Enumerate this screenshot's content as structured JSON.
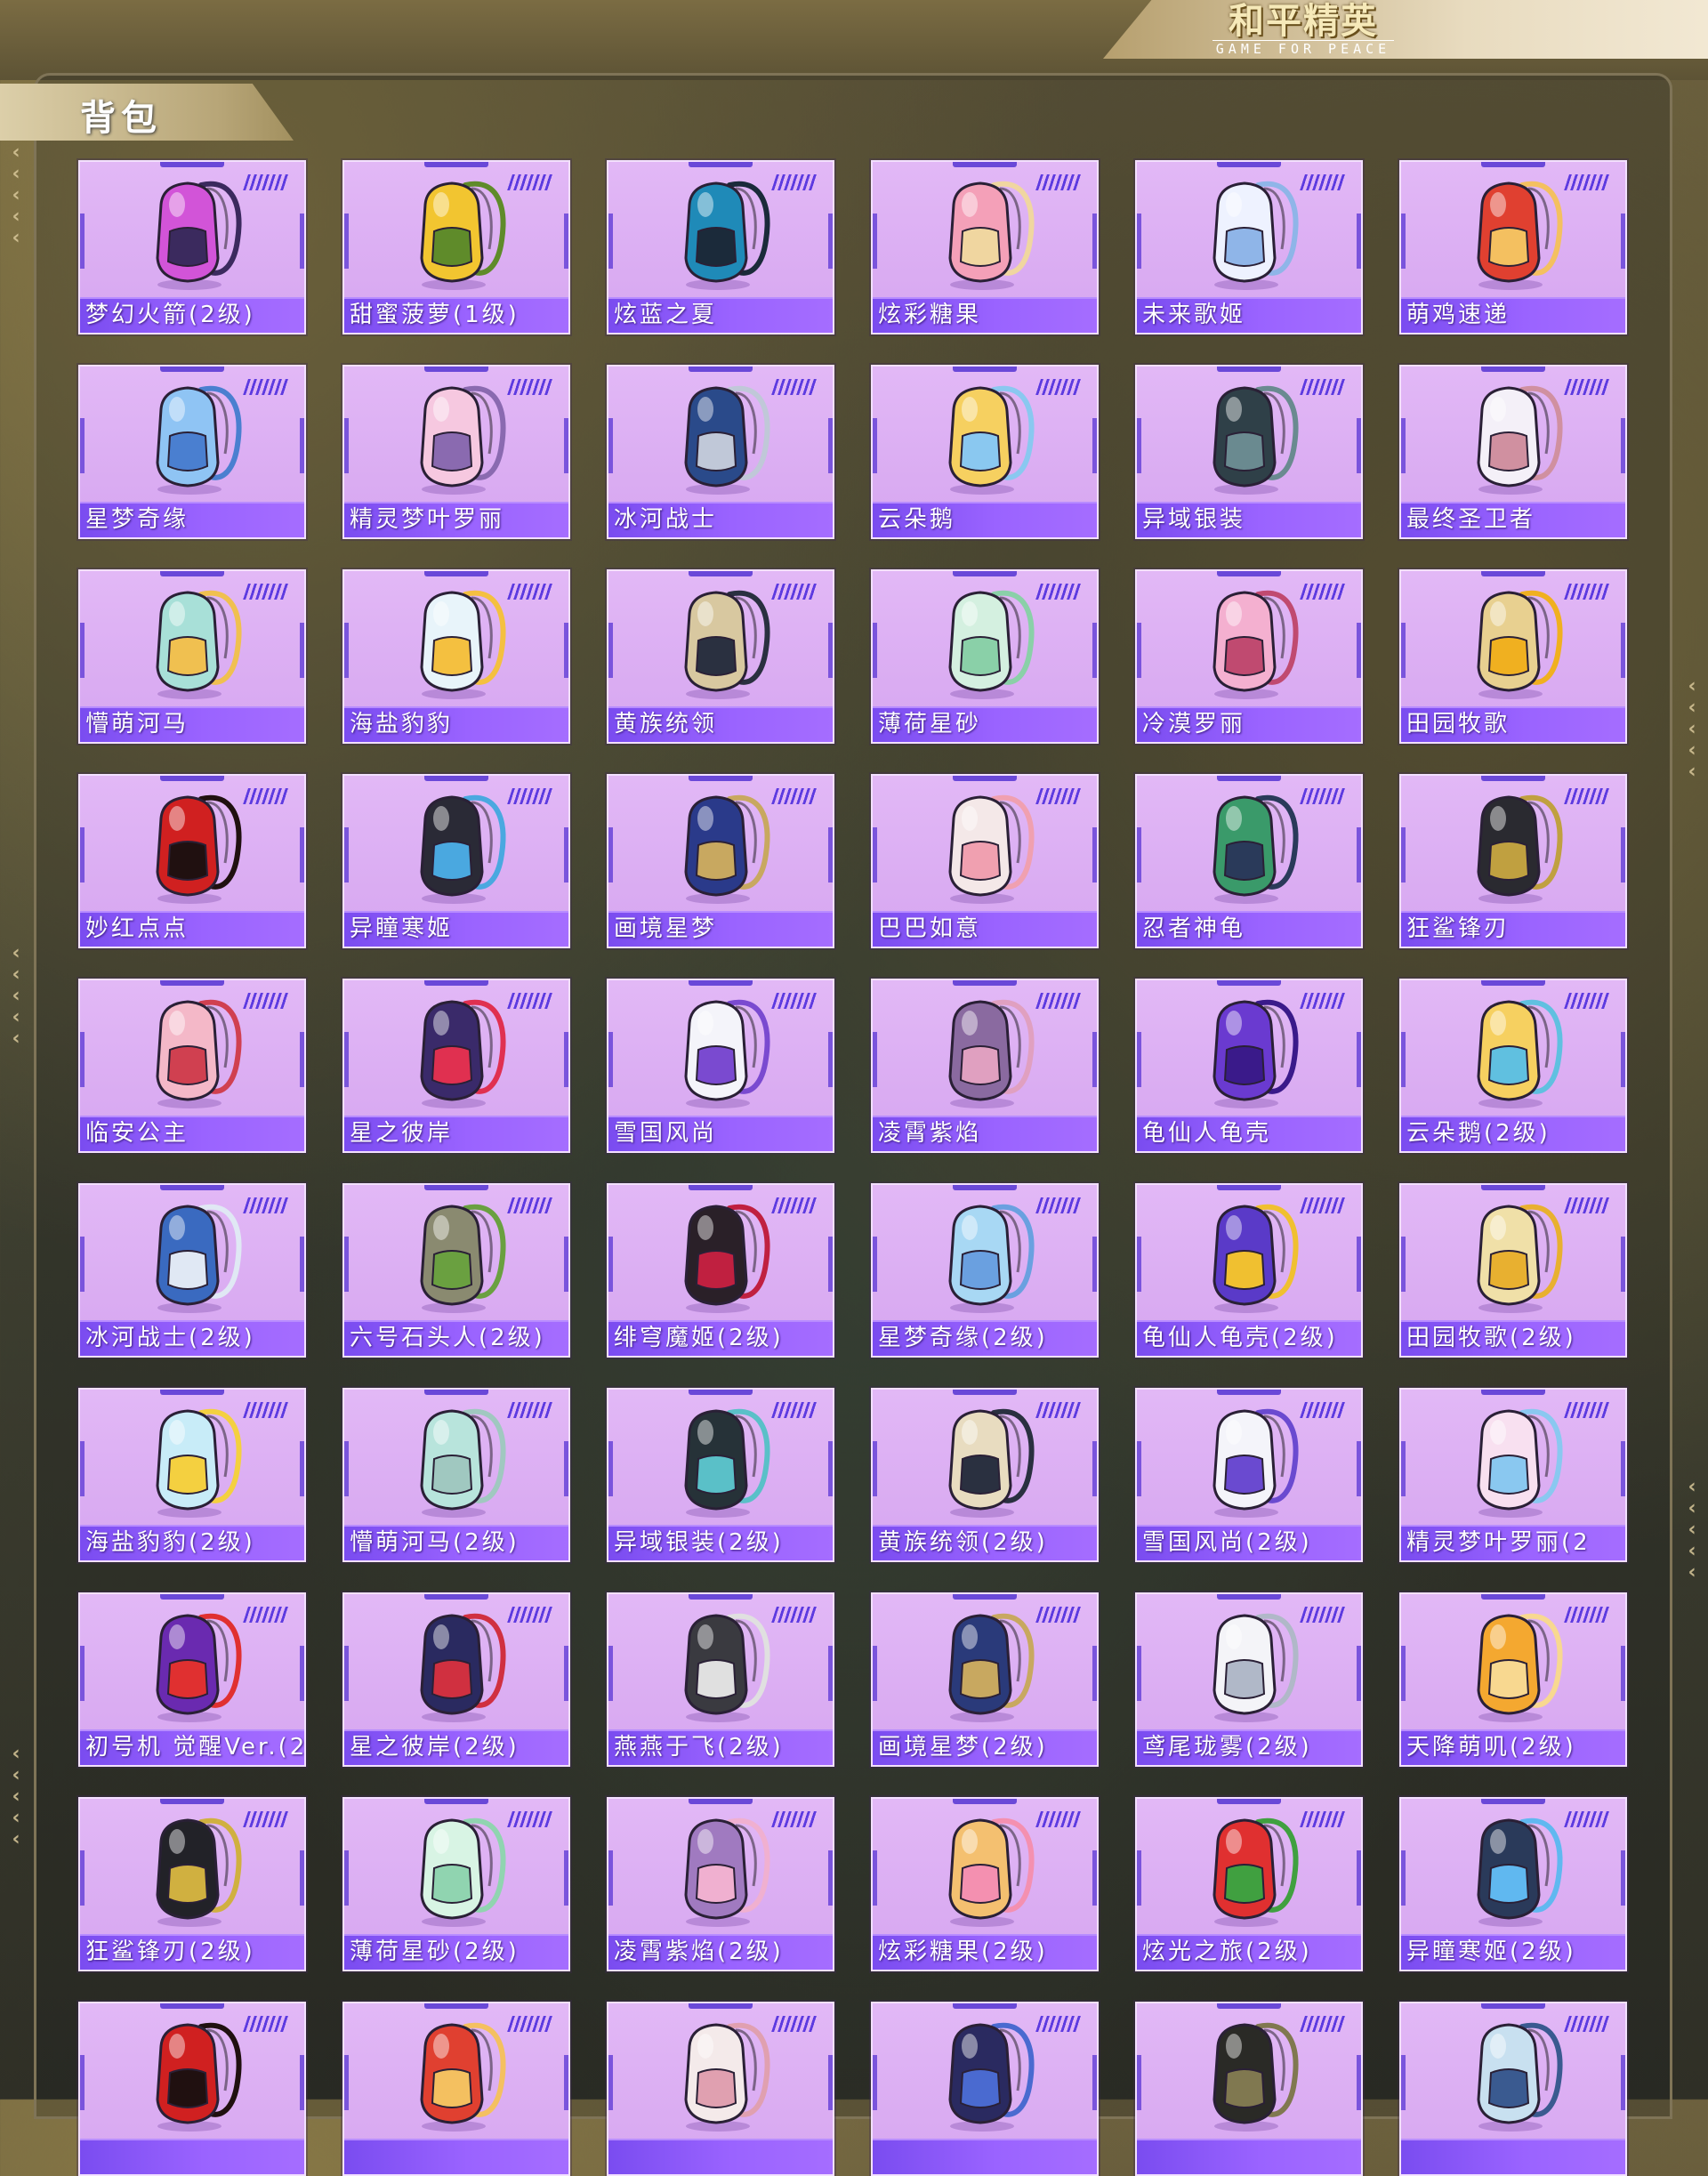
{
  "header": {
    "brand_main": "和平精英",
    "brand_sub": "GAME FOR PEACE"
  },
  "page": {
    "title": "背包"
  },
  "colors": {
    "card_bg": "#dcb0f4",
    "label_bar": "#8a58f5",
    "accent_stripe": "#5d3be0",
    "gold_tab": "#c9b98a"
  },
  "items": [
    {
      "label": "梦幻火箭(2级)",
      "icon": "rocket-backpack-icon",
      "c1": "#d254d8",
      "c2": "#3b2a5e"
    },
    {
      "label": "甜蜜菠萝(1级)",
      "icon": "pineapple-backpack-icon",
      "c1": "#f2c530",
      "c2": "#5f8b2a"
    },
    {
      "label": "炫蓝之夏",
      "icon": "blue-backpack-icon",
      "c1": "#1f8ab8",
      "c2": "#1b2a3a"
    },
    {
      "label": "炫彩糖果",
      "icon": "donut-backpack-icon",
      "c1": "#f4a0b8",
      "c2": "#f0d6a0"
    },
    {
      "label": "未来歌姬",
      "icon": "idol-backpack-icon",
      "c1": "#eef2ff",
      "c2": "#8fb5e8"
    },
    {
      "label": "萌鸡速递",
      "icon": "chick-backpack-icon",
      "c1": "#e04030",
      "c2": "#f4c060"
    },
    {
      "label": "星梦奇缘",
      "icon": "swan-backpack-icon",
      "c1": "#8fc4f4",
      "c2": "#4a7fd0"
    },
    {
      "label": "精灵梦叶罗丽",
      "icon": "heart-backpack-icon",
      "c1": "#f6c8e0",
      "c2": "#8a6ab0"
    },
    {
      "label": "冰河战士",
      "icon": "armor-backpack-icon",
      "c1": "#2a4a8a",
      "c2": "#c0c8d8"
    },
    {
      "label": "云朵鹅",
      "icon": "goose-backpack-icon",
      "c1": "#f6d060",
      "c2": "#8ac8f0"
    },
    {
      "label": "异域银装",
      "icon": "silver-backpack-icon",
      "c1": "#2f4048",
      "c2": "#6a8a90"
    },
    {
      "label": "最终圣卫者",
      "icon": "wing-backpack-icon",
      "c1": "#f4f0f8",
      "c2": "#d090a0"
    },
    {
      "label": "懵萌河马",
      "icon": "hippo-backpack-icon",
      "c1": "#a8e0d8",
      "c2": "#f0c050"
    },
    {
      "label": "海盐豹豹",
      "icon": "seal-backpack-icon",
      "c1": "#e8f4fa",
      "c2": "#f4c040"
    },
    {
      "label": "黄族统领",
      "icon": "golden-backpack-icon",
      "c1": "#d8c8a0",
      "c2": "#2a3040"
    },
    {
      "label": "薄荷星砂",
      "icon": "mint-backpack-icon",
      "c1": "#d4f0e0",
      "c2": "#8ad0a8"
    },
    {
      "label": "冷漠罗丽",
      "icon": "pink-heart-backpack-icon",
      "c1": "#f4b0d0",
      "c2": "#c04a70"
    },
    {
      "label": "田园牧歌",
      "icon": "basket-backpack-icon",
      "c1": "#e8d090",
      "c2": "#f0b020"
    },
    {
      "label": "妙红点点",
      "icon": "ladybug-backpack-icon",
      "c1": "#d02020",
      "c2": "#201010"
    },
    {
      "label": "异瞳寒姬",
      "icon": "cat-backpack-icon",
      "c1": "#2a2a36",
      "c2": "#4aa8e0"
    },
    {
      "label": "画境星梦",
      "icon": "frame-backpack-icon",
      "c1": "#2a3a8a",
      "c2": "#c8a860"
    },
    {
      "label": "巴巴如意",
      "icon": "bunny-backpack-icon",
      "c1": "#f4e8e8",
      "c2": "#f0a0b0"
    },
    {
      "label": "忍者神龟",
      "icon": "turtle-backpack-icon",
      "c1": "#3a9a6a",
      "c2": "#2a3a5a"
    },
    {
      "label": "狂鲨锋刃",
      "icon": "shark-backpack-icon",
      "c1": "#2a2a30",
      "c2": "#c0a040"
    },
    {
      "label": "临安公主",
      "icon": "flower-backpack-icon",
      "c1": "#f4b8c8",
      "c2": "#d04050"
    },
    {
      "label": "星之彼岸",
      "icon": "astronaut-backpack-icon",
      "c1": "#3a2a6a",
      "c2": "#e03050"
    },
    {
      "label": "雪国风尚",
      "icon": "penguin-backpack-icon",
      "c1": "#f4f4fa",
      "c2": "#7a4ad0"
    },
    {
      "label": "凌霄紫焰",
      "icon": "amulet-backpack-icon",
      "c1": "#8a6aa0",
      "c2": "#e0a0c0"
    },
    {
      "label": "龟仙人龟壳",
      "icon": "shell-backpack-icon",
      "c1": "#6a3ad0",
      "c2": "#3a1a8a"
    },
    {
      "label": "云朵鹅(2级)",
      "icon": "goose-backpack-icon",
      "c1": "#f6d060",
      "c2": "#60c0e0"
    },
    {
      "label": "冰河战士(2级)",
      "icon": "armor-backpack-icon",
      "c1": "#3a6ac0",
      "c2": "#e0e8f4"
    },
    {
      "label": "六号石头人(2级)",
      "icon": "stone-backpack-icon",
      "c1": "#8a8a70",
      "c2": "#6aa040"
    },
    {
      "label": "绯穹魔姬(2级)",
      "icon": "demon-backpack-icon",
      "c1": "#2a2028",
      "c2": "#c02040"
    },
    {
      "label": "星梦奇缘(2级)",
      "icon": "swan-backpack-icon",
      "c1": "#a8d8f4",
      "c2": "#6aa0e0"
    },
    {
      "label": "龟仙人龟壳(2级)",
      "icon": "shell-backpack-icon",
      "c1": "#5a3ac8",
      "c2": "#f0c030"
    },
    {
      "label": "田园牧歌(2级)",
      "icon": "basket-backpack-icon",
      "c1": "#f0e0a8",
      "c2": "#e8b030"
    },
    {
      "label": "海盐豹豹(2级)",
      "icon": "seal-backpack-icon",
      "c1": "#c8ecf8",
      "c2": "#f4d040"
    },
    {
      "label": "懵萌河马(2级)",
      "icon": "hippo-backpack-icon",
      "c1": "#b8e4dc",
      "c2": "#a0c8c0"
    },
    {
      "label": "异域银装(2级)",
      "icon": "silver-backpack-icon",
      "c1": "#263238",
      "c2": "#5ac0c8"
    },
    {
      "label": "黄族统领(2级)",
      "icon": "golden-backpack-icon",
      "c1": "#e8dcc0",
      "c2": "#2a3040"
    },
    {
      "label": "雪国风尚(2级)",
      "icon": "penguin-backpack-icon",
      "c1": "#f4f4fa",
      "c2": "#6a4ad0"
    },
    {
      "label": "精灵梦叶罗丽(2",
      "icon": "heart-backpack-icon",
      "c1": "#f8e0f0",
      "c2": "#8ac8f0"
    },
    {
      "label": "初号机 觉醒Ver.(2",
      "icon": "mecha-backpack-icon",
      "c1": "#6a2ab0",
      "c2": "#e03030"
    },
    {
      "label": "星之彼岸(2级)",
      "icon": "astronaut-backpack-icon",
      "c1": "#2a2a60",
      "c2": "#d03040"
    },
    {
      "label": "燕燕于飞(2级)",
      "icon": "bird-backpack-icon",
      "c1": "#3a3a40",
      "c2": "#e0e0e0"
    },
    {
      "label": "画境星梦(2级)",
      "icon": "book-backpack-icon",
      "c1": "#2a3a7a",
      "c2": "#c8a860"
    },
    {
      "label": "鸢尾珑雾(2级)",
      "icon": "pouch-backpack-icon",
      "c1": "#f4f4f8",
      "c2": "#b0b8c8"
    },
    {
      "label": "天降萌叽(2级)",
      "icon": "orange-backpack-icon",
      "c1": "#f4a830",
      "c2": "#f8d890"
    },
    {
      "label": "狂鲨锋刃(2级)",
      "icon": "shark-backpack-icon",
      "c1": "#222228",
      "c2": "#d0b040"
    },
    {
      "label": "薄荷星砂(2级)",
      "icon": "mint-backpack-icon",
      "c1": "#d8f4e4",
      "c2": "#90d4b0"
    },
    {
      "label": "凌霄紫焰(2级)",
      "icon": "amulet-backpack-icon",
      "c1": "#a07ac0",
      "c2": "#f0b0d0"
    },
    {
      "label": "炫彩糖果(2级)",
      "icon": "donut-backpack-icon",
      "c1": "#f4c070",
      "c2": "#f490b0"
    },
    {
      "label": "炫光之旅(2级)",
      "icon": "arcade-backpack-icon",
      "c1": "#e03030",
      "c2": "#40a040"
    },
    {
      "label": "异瞳寒姬(2级)",
      "icon": "cat-backpack-icon",
      "c1": "#2a3a5a",
      "c2": "#60b8f0"
    },
    {
      "label": "",
      "icon": "ladybug-backpack-icon",
      "c1": "#d02020",
      "c2": "#201010"
    },
    {
      "label": "",
      "icon": "chick-backpack-icon",
      "c1": "#e04030",
      "c2": "#f4c060"
    },
    {
      "label": "",
      "icon": "bunny-backpack-icon",
      "c1": "#f4eaea",
      "c2": "#e0a0b0"
    },
    {
      "label": "",
      "icon": "astronaut-backpack-icon",
      "c1": "#2a2a60",
      "c2": "#4a6ad0"
    },
    {
      "label": "",
      "icon": "tactical-backpack-icon",
      "c1": "#2a2a26",
      "c2": "#807850"
    },
    {
      "label": "",
      "icon": "tech-backpack-icon",
      "c1": "#c8e0f0",
      "c2": "#3a5a90"
    }
  ]
}
